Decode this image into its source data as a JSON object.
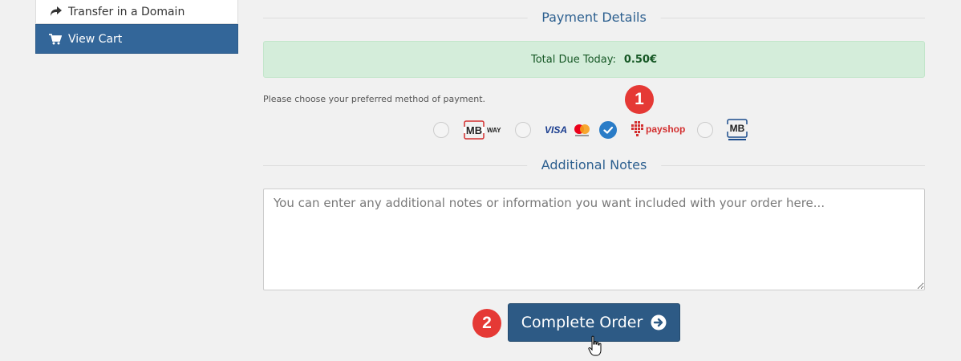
{
  "sidebar": {
    "items": [
      {
        "label": "Transfer in a Domain",
        "icon": "share-arrow-icon"
      },
      {
        "label": "View Cart",
        "icon": "shopping-cart-icon",
        "active": true
      }
    ]
  },
  "payment": {
    "heading": "Payment Details",
    "total_label": "Total Due Today:",
    "total_value": "0.50€",
    "instructions": "Please choose your preferred method of payment.",
    "methods": [
      {
        "name": "MB WAY",
        "selected": false
      },
      {
        "name": "VISA / Mastercard",
        "selected": false
      },
      {
        "name": "payshop",
        "selected": true
      },
      {
        "name": "Multibanco",
        "selected": false
      }
    ]
  },
  "notes": {
    "heading": "Additional Notes",
    "placeholder": "You can enter any additional notes or information you want included with your order here..."
  },
  "actions": {
    "complete_label": "Complete Order"
  },
  "annotations": {
    "step1": "1",
    "step2": "2"
  },
  "colors": {
    "primary": "#336699",
    "button": "#2d5a85",
    "success_bg": "#d4edda",
    "badge": "#e53935",
    "radio_checked": "#2a7cc7"
  }
}
